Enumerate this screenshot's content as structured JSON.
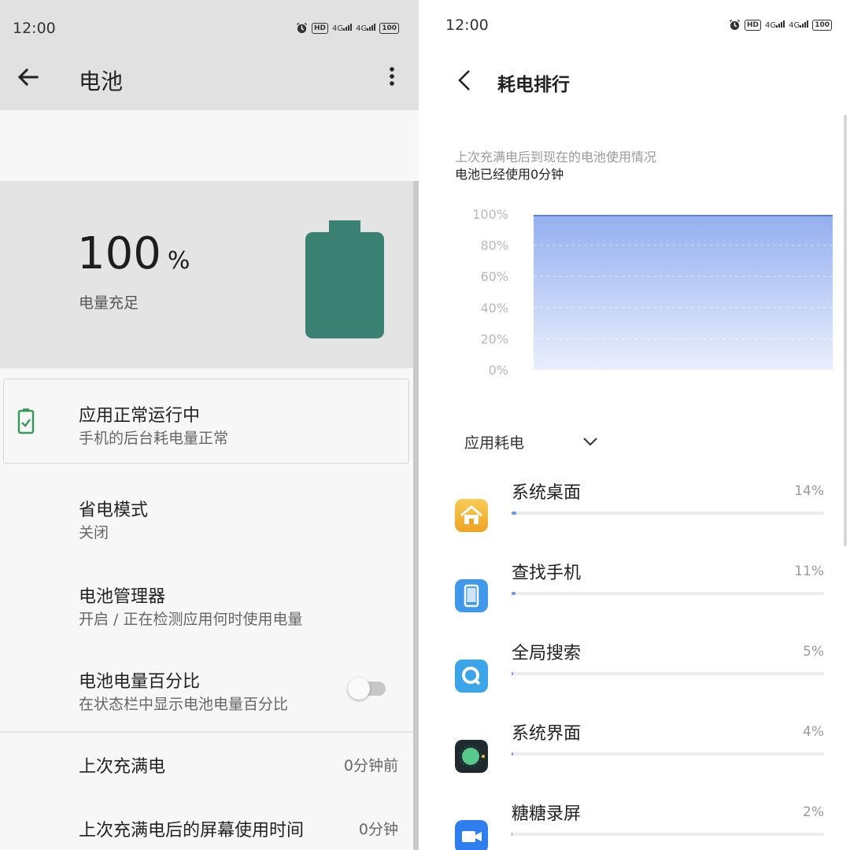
{
  "left": {
    "status": {
      "time": "12:00",
      "hd": "HD",
      "net1": "4G",
      "net2": "4G",
      "battery": "100"
    },
    "header": {
      "title": "电池"
    },
    "hero": {
      "percent": "100",
      "unit": "%",
      "status": "电量充足",
      "battery_color": "#3a8174"
    },
    "notice": {
      "title": "应用正常运行中",
      "subtitle": "手机的后台耗电量正常",
      "icon_color": "#3a9a5a"
    },
    "settings": [
      {
        "title": "省电模式",
        "subtitle": "关闭"
      },
      {
        "title": "电池管理器",
        "subtitle": "开启 / 正在检测应用何时使用电量"
      },
      {
        "title": "电池电量百分比",
        "subtitle": "在状态栏中显示电池电量百分比",
        "toggle_on": false
      }
    ],
    "stats": [
      {
        "label": "上次充满电",
        "value": "0分钟前"
      },
      {
        "label": "上次充满电后的屏幕使用时间",
        "value": "0分钟"
      }
    ]
  },
  "right": {
    "status": {
      "time": "12:00",
      "hd": "HD",
      "net1": "4G",
      "net2": "4G",
      "battery": "100"
    },
    "header": {
      "title": "耗电排行"
    },
    "desc": {
      "line1": "上次充满电后到现在的电池使用情况",
      "line2": "电池已经使用0分钟"
    },
    "chart_data": {
      "type": "area",
      "y_ticks": [
        "100%",
        "80%",
        "60%",
        "40%",
        "20%",
        "0%"
      ],
      "ylim": [
        0,
        100
      ],
      "series": [
        {
          "values": [
            99,
            99
          ]
        }
      ],
      "grid": true,
      "line_color": "#5b7fd8",
      "fill_top_color": "#94b0f0",
      "fill_bottom_color": "#e9eefc"
    },
    "filter": {
      "label": "应用耗电"
    },
    "apps": [
      {
        "name": "系统桌面",
        "percent": "14%",
        "value": 14,
        "icon": "home-icon",
        "color": "#f3b63a"
      },
      {
        "name": "查找手机",
        "percent": "11%",
        "value": 11,
        "icon": "phone-icon",
        "color": "#3f98ea"
      },
      {
        "name": "全局搜索",
        "percent": "5%",
        "value": 5,
        "icon": "search-icon",
        "color": "#3aa5e8"
      },
      {
        "name": "系统界面",
        "percent": "4%",
        "value": 4,
        "icon": "system-ui-icon",
        "color": "#1e2a2e"
      },
      {
        "name": "糖糖录屏",
        "percent": "2%",
        "value": 2,
        "icon": "video-camera-icon",
        "color": "#2f7ef0"
      }
    ]
  }
}
